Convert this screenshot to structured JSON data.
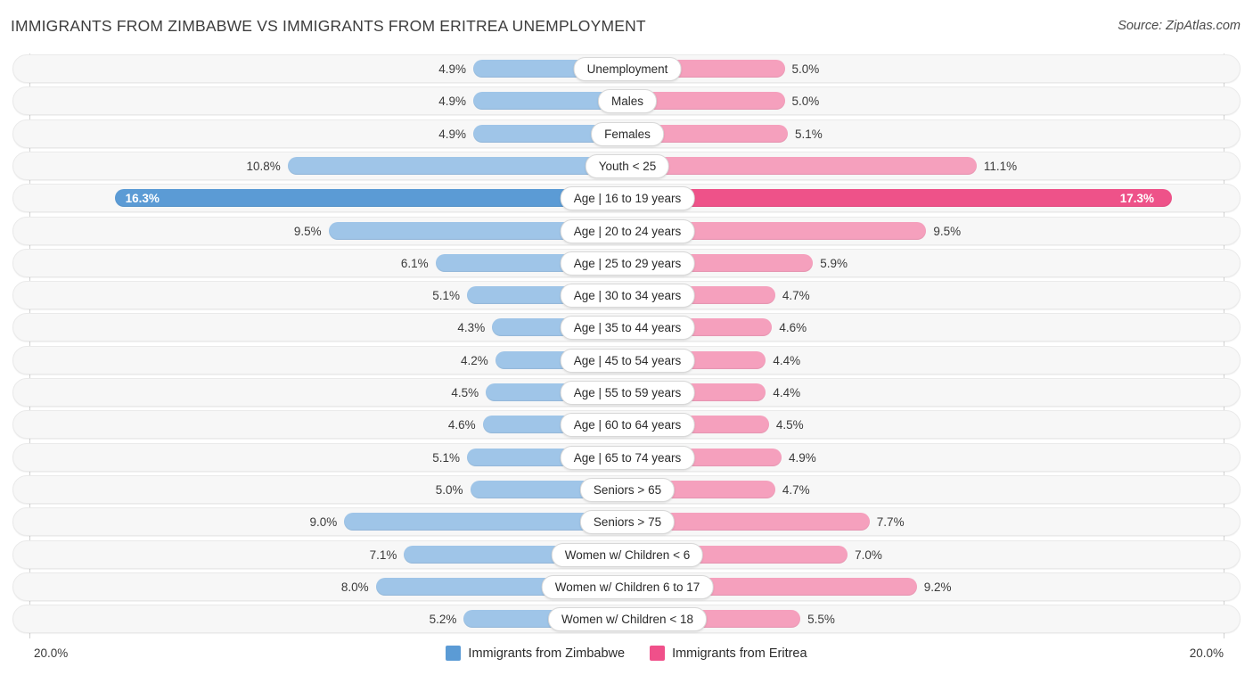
{
  "header": {
    "title": "IMMIGRANTS FROM ZIMBABWE VS IMMIGRANTS FROM ERITREA UNEMPLOYMENT",
    "source": "Source: ZipAtlas.com"
  },
  "legend": {
    "items": [
      {
        "label": "Immigrants from Zimbabwe",
        "color": "#5b9bd5"
      },
      {
        "label": "Immigrants from Eritrea",
        "color": "#f0508a"
      }
    ]
  },
  "axis": {
    "left_label": "20.0%",
    "right_label": "20.0%",
    "max": 20.0
  },
  "colors": {
    "left_bar": "#9fc5e8",
    "right_bar": "#f5a0bd",
    "left_bar_highlight": "#5b9bd5",
    "right_bar_highlight": "#ee5289",
    "row_bg": "#f7f7f7",
    "row_border": "#eaeaea"
  },
  "chart_data": {
    "type": "bar",
    "orientation": "horizontal-diverging",
    "title": "IMMIGRANTS FROM ZIMBABWE VS IMMIGRANTS FROM ERITREA UNEMPLOYMENT",
    "xlabel": "",
    "ylabel": "",
    "xlim": [
      20.0,
      20.0
    ],
    "grid": false,
    "legend_position": "bottom-center",
    "categories": [
      "Unemployment",
      "Males",
      "Females",
      "Youth < 25",
      "Age | 16 to 19 years",
      "Age | 20 to 24 years",
      "Age | 25 to 29 years",
      "Age | 30 to 34 years",
      "Age | 35 to 44 years",
      "Age | 45 to 54 years",
      "Age | 55 to 59 years",
      "Age | 60 to 64 years",
      "Age | 65 to 74 years",
      "Seniors > 65",
      "Seniors > 75",
      "Women w/ Children < 6",
      "Women w/ Children 6 to 17",
      "Women w/ Children < 18"
    ],
    "series": [
      {
        "name": "Immigrants from Zimbabwe",
        "values": [
          4.9,
          4.9,
          4.9,
          10.8,
          16.3,
          9.5,
          6.1,
          5.1,
          4.3,
          4.2,
          4.5,
          4.6,
          5.1,
          5.0,
          9.0,
          7.1,
          8.0,
          5.2
        ],
        "labels": [
          "4.9%",
          "4.9%",
          "4.9%",
          "10.8%",
          "16.3%",
          "9.5%",
          "6.1%",
          "5.1%",
          "4.3%",
          "4.2%",
          "4.5%",
          "4.6%",
          "5.1%",
          "5.0%",
          "9.0%",
          "7.1%",
          "8.0%",
          "5.2%"
        ]
      },
      {
        "name": "Immigrants from Eritrea",
        "values": [
          5.0,
          5.0,
          5.1,
          11.1,
          17.3,
          9.5,
          5.9,
          4.7,
          4.6,
          4.4,
          4.4,
          4.5,
          4.9,
          4.7,
          7.7,
          7.0,
          9.2,
          5.5
        ],
        "labels": [
          "5.0%",
          "5.0%",
          "5.1%",
          "11.1%",
          "17.3%",
          "9.5%",
          "5.9%",
          "4.7%",
          "4.6%",
          "4.4%",
          "4.4%",
          "4.5%",
          "4.9%",
          "4.7%",
          "7.7%",
          "7.0%",
          "9.2%",
          "5.5%"
        ]
      }
    ],
    "highlighted_index": 4
  }
}
